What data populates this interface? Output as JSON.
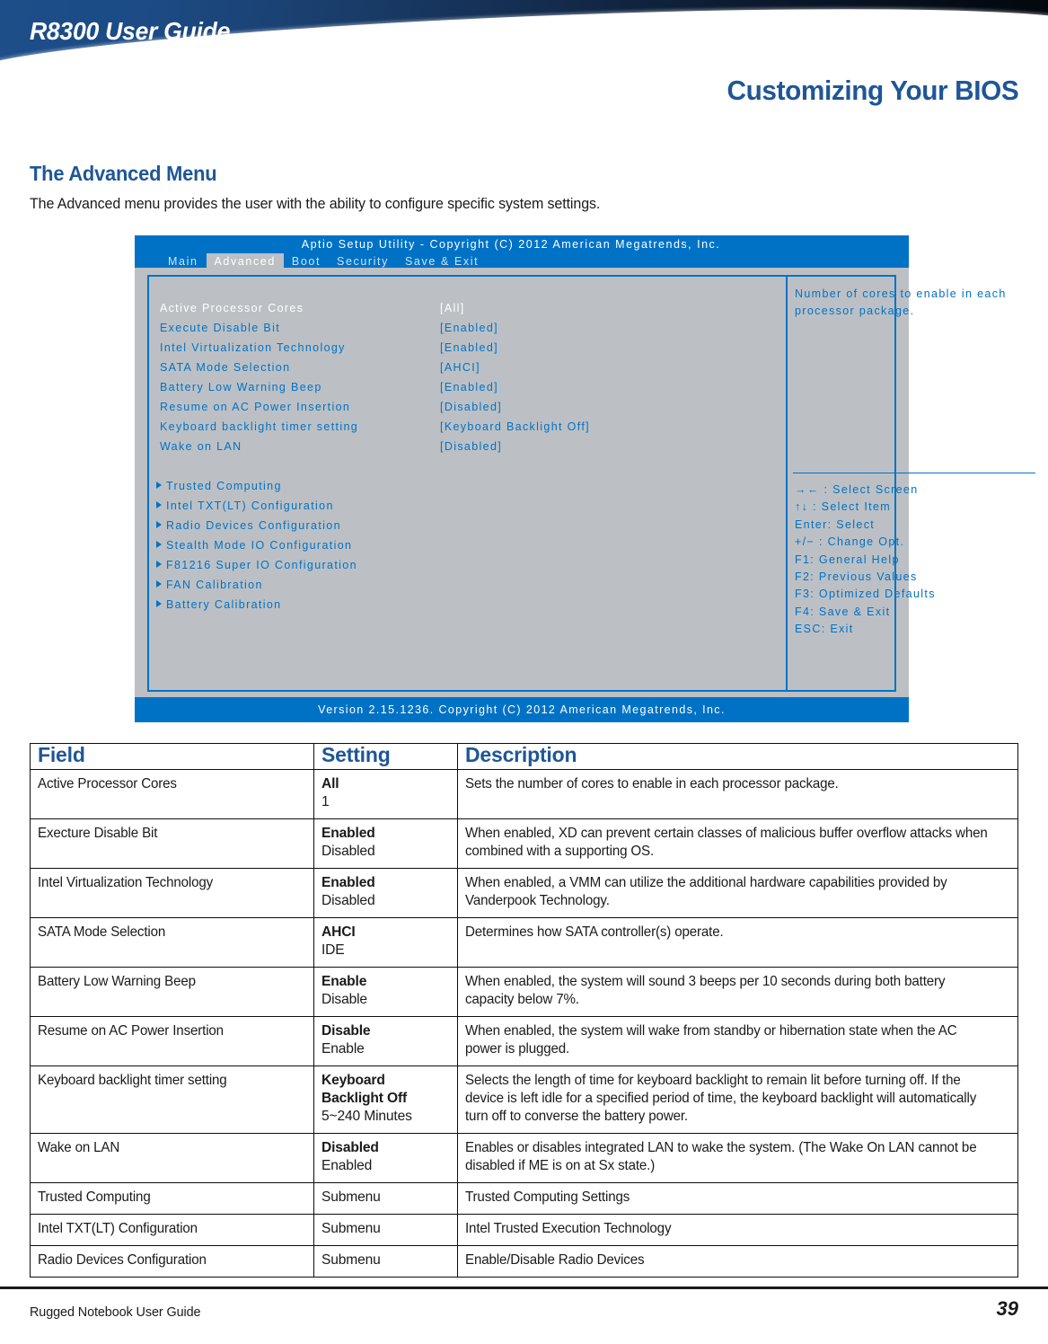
{
  "header": {
    "doc_title": "R8300 User Guide",
    "chapter_title": "Customizing Your BIOS",
    "brand_blue": "#1f5696",
    "banner_dark": "#03070d"
  },
  "section": {
    "heading": "The Advanced Menu",
    "intro": "The Advanced menu provides the user with the ability to configure specific system settings."
  },
  "bios": {
    "title": "Aptio Setup Utility - Copyright (C) 2012 American Megatrends, Inc.",
    "footer": "Version 2.15.1236. Copyright (C) 2012 American Megatrends, Inc.",
    "accent": "#0072c6",
    "panel_bg": "#bcc0c4",
    "tabs": [
      {
        "label": "Main",
        "active": false
      },
      {
        "label": "Advanced",
        "active": true
      },
      {
        "label": "Boot",
        "active": false
      },
      {
        "label": "Security",
        "active": false
      },
      {
        "label": "Save & Exit",
        "active": false
      }
    ],
    "options": [
      {
        "label": "Active Processor Cores",
        "value": "[All]",
        "selected": true
      },
      {
        "label": "Execute Disable Bit",
        "value": "[Enabled]",
        "selected": false
      },
      {
        "label": "Intel Virtualization Technology",
        "value": "[Enabled]",
        "selected": false
      },
      {
        "label": "SATA Mode Selection",
        "value": "[AHCI]",
        "selected": false
      },
      {
        "label": "Battery Low Warning Beep",
        "value": "[Enabled]",
        "selected": false
      },
      {
        "label": "Resume on AC Power Insertion",
        "value": "[Disabled]",
        "selected": false
      },
      {
        "label": "Keyboard backlight timer setting",
        "value": "[Keyboard Backlight Off]",
        "selected": false
      },
      {
        "label": "Wake on LAN",
        "value": "[Disabled]",
        "selected": false
      }
    ],
    "submenus": [
      {
        "label": "Trusted Computing"
      },
      {
        "label": "Intel TXT(LT) Configuration"
      },
      {
        "label": "Radio Devices Configuration"
      },
      {
        "label": "Stealth Mode IO Configuration"
      },
      {
        "label": "F81216 Super IO Configuration"
      },
      {
        "label": "FAN Calibration"
      },
      {
        "label": "Battery Calibration"
      }
    ],
    "help_text": "Number of cores to enable in each processor package.",
    "keys": [
      "→← : Select Screen",
      "↑↓ : Select Item",
      "Enter: Select",
      "+/− : Change Opt.",
      "F1: General Help",
      "F2: Previous Values",
      "F3: Optimized Defaults",
      "F4: Save & Exit",
      "ESC: Exit"
    ]
  },
  "table": {
    "headers": {
      "field": "Field",
      "setting": "Setting",
      "description": "Description"
    },
    "rows": [
      {
        "field": "Active Processor Cores",
        "setting_primary": "All",
        "setting_secondary": "1",
        "description": "Sets the number of cores to enable in each processor package."
      },
      {
        "field": "Execture Disable Bit",
        "setting_primary": "Enabled",
        "setting_secondary": "Disabled",
        "description": "When enabled, XD can prevent certain classes of malicious buffer overflow attacks when combined with a supporting OS."
      },
      {
        "field": "Intel Virtualization Technology",
        "setting_primary": "Enabled",
        "setting_secondary": "Disabled",
        "description": "When enabled, a VMM can utilize the additional hardware capabilities provided by Vanderpook Technology."
      },
      {
        "field": "SATA Mode Selection",
        "setting_primary": "AHCI",
        "setting_secondary": "IDE",
        "description": "Determines how SATA controller(s) operate."
      },
      {
        "field": "Battery Low Warning Beep",
        "setting_primary": "Enable",
        "setting_secondary": "Disable",
        "description": "When enabled, the system will sound 3 beeps per 10 seconds during both battery capacity below 7%."
      },
      {
        "field": "Resume on AC Power Insertion",
        "setting_primary": "Disable",
        "setting_secondary": "Enable",
        "description": "When enabled, the system will wake from standby or hibernation state when the AC power is plugged."
      },
      {
        "field": "Keyboard backlight timer setting",
        "setting_primary": "Keyboard Backlight Off",
        "setting_secondary": "5~240 Minutes",
        "description": "Selects the length of time for keyboard backlight to remain lit before turning off. If the device is left idle for a specified period of time, the keyboard backlight will automatically turn off to converse the battery power."
      },
      {
        "field": "Wake on LAN",
        "setting_primary": "Disabled",
        "setting_secondary": "Enabled",
        "description": "Enables or disables integrated LAN to wake the system. (The Wake On LAN cannot be disabled if ME is on at Sx state.)"
      },
      {
        "field": "Trusted Computing",
        "setting_primary": "",
        "setting_secondary": "Submenu",
        "description": "Trusted Computing Settings"
      },
      {
        "field": "Intel TXT(LT) Configuration",
        "setting_primary": "",
        "setting_secondary": "Submenu",
        "description": "Intel Trusted Execution Technology"
      },
      {
        "field": "Radio Devices Configuration",
        "setting_primary": "",
        "setting_secondary": "Submenu",
        "description": "Enable/Disable Radio Devices"
      }
    ]
  },
  "footer": {
    "left": "Rugged Notebook User Guide",
    "page": "39"
  }
}
